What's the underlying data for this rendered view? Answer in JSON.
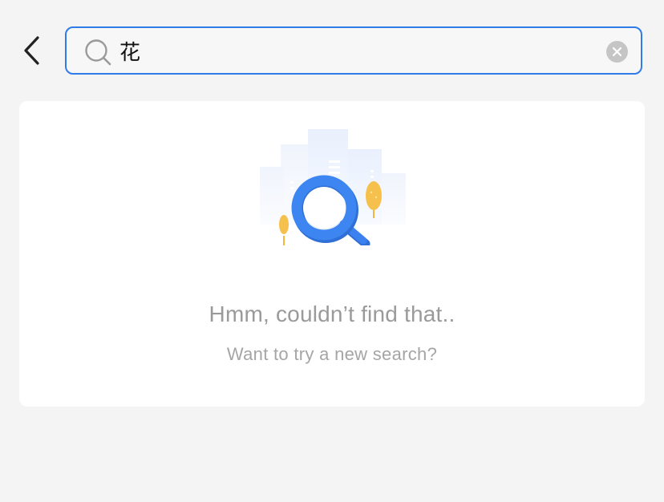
{
  "search": {
    "value": "花",
    "placeholder": ""
  },
  "empty_state": {
    "title": "Hmm, couldn’t find that..",
    "subtitle": "Want to try a new search?"
  },
  "icons": {
    "back": "chevron-left-icon",
    "search": "search-icon",
    "clear": "clear-icon",
    "illustration": "no-results-magnifier-illustration"
  },
  "colors": {
    "accent": "#2f7ce8",
    "background": "#f4f4f4",
    "card": "#ffffff",
    "muted_text": "#9a9a9a",
    "tree_yellow": "#f6c04c"
  }
}
